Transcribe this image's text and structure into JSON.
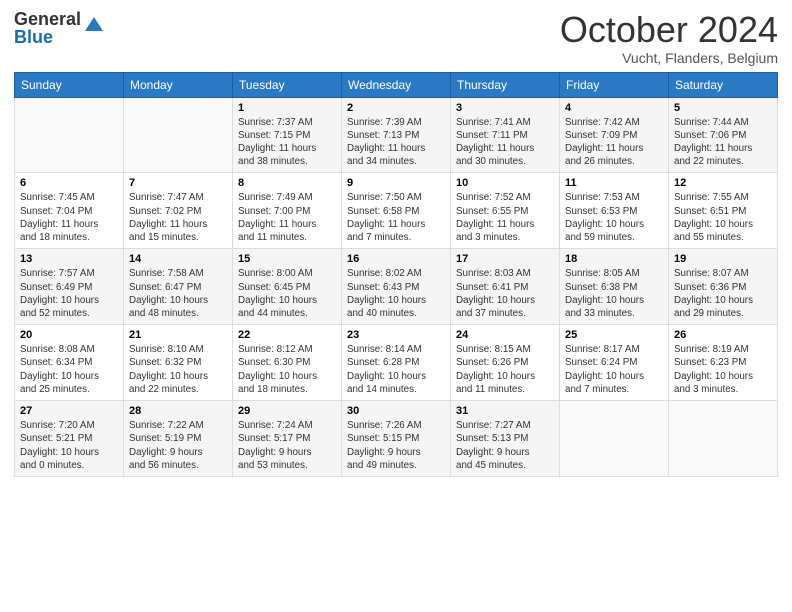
{
  "header": {
    "logo_general": "General",
    "logo_blue": "Blue",
    "month_year": "October 2024",
    "location": "Vucht, Flanders, Belgium"
  },
  "days_of_week": [
    "Sunday",
    "Monday",
    "Tuesday",
    "Wednesday",
    "Thursday",
    "Friday",
    "Saturday"
  ],
  "weeks": [
    [
      {
        "day": "",
        "info": ""
      },
      {
        "day": "",
        "info": ""
      },
      {
        "day": "1",
        "info": "Sunrise: 7:37 AM\nSunset: 7:15 PM\nDaylight: 11 hours\nand 38 minutes."
      },
      {
        "day": "2",
        "info": "Sunrise: 7:39 AM\nSunset: 7:13 PM\nDaylight: 11 hours\nand 34 minutes."
      },
      {
        "day": "3",
        "info": "Sunrise: 7:41 AM\nSunset: 7:11 PM\nDaylight: 11 hours\nand 30 minutes."
      },
      {
        "day": "4",
        "info": "Sunrise: 7:42 AM\nSunset: 7:09 PM\nDaylight: 11 hours\nand 26 minutes."
      },
      {
        "day": "5",
        "info": "Sunrise: 7:44 AM\nSunset: 7:06 PM\nDaylight: 11 hours\nand 22 minutes."
      }
    ],
    [
      {
        "day": "6",
        "info": "Sunrise: 7:45 AM\nSunset: 7:04 PM\nDaylight: 11 hours\nand 18 minutes."
      },
      {
        "day": "7",
        "info": "Sunrise: 7:47 AM\nSunset: 7:02 PM\nDaylight: 11 hours\nand 15 minutes."
      },
      {
        "day": "8",
        "info": "Sunrise: 7:49 AM\nSunset: 7:00 PM\nDaylight: 11 hours\nand 11 minutes."
      },
      {
        "day": "9",
        "info": "Sunrise: 7:50 AM\nSunset: 6:58 PM\nDaylight: 11 hours\nand 7 minutes."
      },
      {
        "day": "10",
        "info": "Sunrise: 7:52 AM\nSunset: 6:55 PM\nDaylight: 11 hours\nand 3 minutes."
      },
      {
        "day": "11",
        "info": "Sunrise: 7:53 AM\nSunset: 6:53 PM\nDaylight: 10 hours\nand 59 minutes."
      },
      {
        "day": "12",
        "info": "Sunrise: 7:55 AM\nSunset: 6:51 PM\nDaylight: 10 hours\nand 55 minutes."
      }
    ],
    [
      {
        "day": "13",
        "info": "Sunrise: 7:57 AM\nSunset: 6:49 PM\nDaylight: 10 hours\nand 52 minutes."
      },
      {
        "day": "14",
        "info": "Sunrise: 7:58 AM\nSunset: 6:47 PM\nDaylight: 10 hours\nand 48 minutes."
      },
      {
        "day": "15",
        "info": "Sunrise: 8:00 AM\nSunset: 6:45 PM\nDaylight: 10 hours\nand 44 minutes."
      },
      {
        "day": "16",
        "info": "Sunrise: 8:02 AM\nSunset: 6:43 PM\nDaylight: 10 hours\nand 40 minutes."
      },
      {
        "day": "17",
        "info": "Sunrise: 8:03 AM\nSunset: 6:41 PM\nDaylight: 10 hours\nand 37 minutes."
      },
      {
        "day": "18",
        "info": "Sunrise: 8:05 AM\nSunset: 6:38 PM\nDaylight: 10 hours\nand 33 minutes."
      },
      {
        "day": "19",
        "info": "Sunrise: 8:07 AM\nSunset: 6:36 PM\nDaylight: 10 hours\nand 29 minutes."
      }
    ],
    [
      {
        "day": "20",
        "info": "Sunrise: 8:08 AM\nSunset: 6:34 PM\nDaylight: 10 hours\nand 25 minutes."
      },
      {
        "day": "21",
        "info": "Sunrise: 8:10 AM\nSunset: 6:32 PM\nDaylight: 10 hours\nand 22 minutes."
      },
      {
        "day": "22",
        "info": "Sunrise: 8:12 AM\nSunset: 6:30 PM\nDaylight: 10 hours\nand 18 minutes."
      },
      {
        "day": "23",
        "info": "Sunrise: 8:14 AM\nSunset: 6:28 PM\nDaylight: 10 hours\nand 14 minutes."
      },
      {
        "day": "24",
        "info": "Sunrise: 8:15 AM\nSunset: 6:26 PM\nDaylight: 10 hours\nand 11 minutes."
      },
      {
        "day": "25",
        "info": "Sunrise: 8:17 AM\nSunset: 6:24 PM\nDaylight: 10 hours\nand 7 minutes."
      },
      {
        "day": "26",
        "info": "Sunrise: 8:19 AM\nSunset: 6:23 PM\nDaylight: 10 hours\nand 3 minutes."
      }
    ],
    [
      {
        "day": "27",
        "info": "Sunrise: 7:20 AM\nSunset: 5:21 PM\nDaylight: 10 hours\nand 0 minutes."
      },
      {
        "day": "28",
        "info": "Sunrise: 7:22 AM\nSunset: 5:19 PM\nDaylight: 9 hours\nand 56 minutes."
      },
      {
        "day": "29",
        "info": "Sunrise: 7:24 AM\nSunset: 5:17 PM\nDaylight: 9 hours\nand 53 minutes."
      },
      {
        "day": "30",
        "info": "Sunrise: 7:26 AM\nSunset: 5:15 PM\nDaylight: 9 hours\nand 49 minutes."
      },
      {
        "day": "31",
        "info": "Sunrise: 7:27 AM\nSunset: 5:13 PM\nDaylight: 9 hours\nand 45 minutes."
      },
      {
        "day": "",
        "info": ""
      },
      {
        "day": "",
        "info": ""
      }
    ]
  ]
}
